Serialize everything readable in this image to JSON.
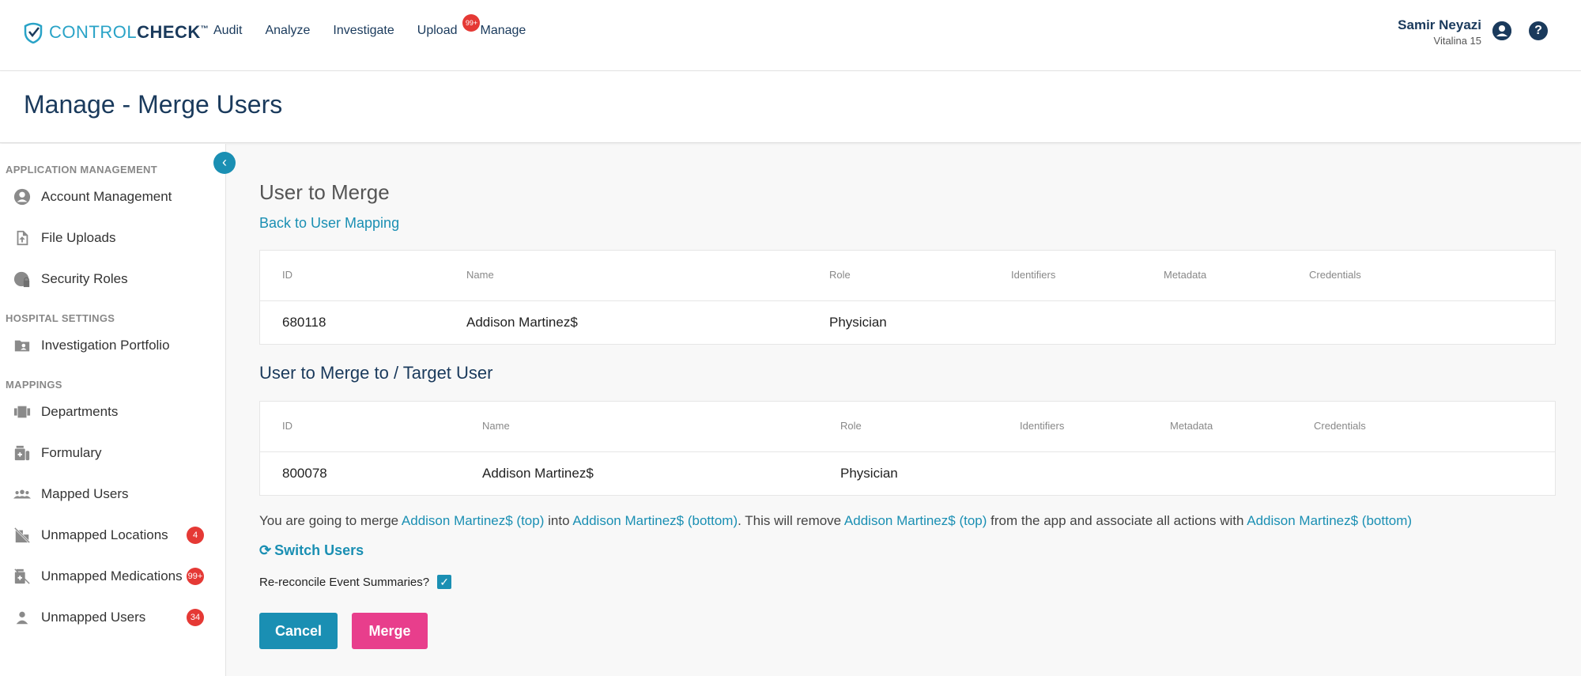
{
  "app": {
    "logo_part1": "CONTROL",
    "logo_part2": "CHECK",
    "logo_tm": "™"
  },
  "nav": {
    "items": [
      {
        "label": "Audit"
      },
      {
        "label": "Analyze"
      },
      {
        "label": "Investigate"
      },
      {
        "label": "Upload",
        "badge": "99+"
      },
      {
        "label": "Manage"
      }
    ]
  },
  "user": {
    "name": "Samir Neyazi",
    "subtitle": "Vitalina 15"
  },
  "page": {
    "title": "Manage - Merge Users"
  },
  "sidebar": {
    "sections": [
      {
        "label": "APPLICATION MANAGEMENT"
      },
      {
        "label": "HOSPITAL SETTINGS"
      },
      {
        "label": "MAPPINGS"
      }
    ],
    "items": [
      {
        "label": "Account Management",
        "icon": "account-circle-icon"
      },
      {
        "label": "File Uploads",
        "icon": "file-upload-icon"
      },
      {
        "label": "Security Roles",
        "icon": "security-globe-icon"
      },
      {
        "label": "Investigation Portfolio",
        "icon": "folder-user-icon"
      },
      {
        "label": "Departments",
        "icon": "departments-icon"
      },
      {
        "label": "Formulary",
        "icon": "formulary-icon"
      },
      {
        "label": "Mapped Users",
        "icon": "users-group-icon"
      },
      {
        "label": "Unmapped Locations",
        "icon": "location-off-icon",
        "badge": "4"
      },
      {
        "label": "Unmapped Medications",
        "icon": "medication-off-icon",
        "badge": "99+"
      },
      {
        "label": "Unmapped Users",
        "icon": "person-icon",
        "badge": "34"
      }
    ]
  },
  "main": {
    "title": "User to Merge",
    "back_link": "Back to User Mapping",
    "target_title": "User to Merge to / Target User",
    "columns": [
      "ID",
      "Name",
      "Role",
      "Identifiers",
      "Metadata",
      "Credentials"
    ],
    "source_user": {
      "id": "680118",
      "name": "Addison Martinez$",
      "role": "Physician",
      "identifiers": "",
      "metadata": "",
      "credentials": ""
    },
    "target_user": {
      "id": "800078",
      "name": "Addison Martinez$",
      "role": "Physician",
      "identifiers": "",
      "metadata": "",
      "credentials": ""
    },
    "merge_msg": {
      "t1": "You are going to merge ",
      "l1": "Addison Martinez$ (top)",
      "t2": " into ",
      "l2": "Addison Martinez$ (bottom)",
      "t3": ". This will remove ",
      "l3": "Addison Martinez$ (top)",
      "t4": " from the app and associate all actions with ",
      "l4": "Addison Martinez$ (bottom)"
    },
    "switch_label": "Switch Users",
    "rereconcile_label": "Re-reconcile Event Summaries?",
    "rereconcile_checked": true,
    "cancel_label": "Cancel",
    "merge_label": "Merge"
  },
  "colors": {
    "accent": "#1a8fb3",
    "navy": "#1a3a5c",
    "merge": "#e83e8c",
    "badge": "#e53935"
  }
}
